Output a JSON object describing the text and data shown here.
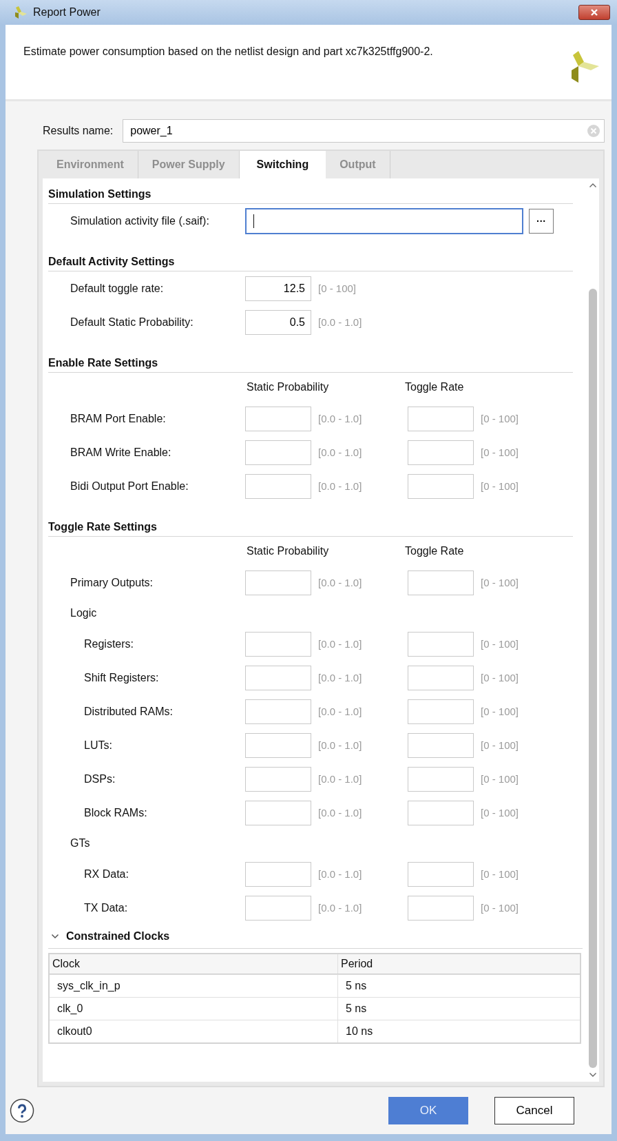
{
  "window": {
    "title": "Report Power"
  },
  "header": {
    "description": "Estimate power consumption based on the netlist design and part xc7k325tffg900-2."
  },
  "results_name": {
    "label": "Results name:",
    "value": "power_1"
  },
  "tabs": [
    {
      "label": "Environment",
      "selected": false
    },
    {
      "label": "Power Supply",
      "selected": false
    },
    {
      "label": "Switching",
      "selected": true
    },
    {
      "label": "Output",
      "selected": false
    }
  ],
  "sections": [
    {
      "title": "Simulation Settings",
      "rows": [
        {
          "kind": "file",
          "label": "Simulation activity file (.saif):",
          "focused": true,
          "button": "···"
        }
      ]
    },
    {
      "title": "Default Activity Settings",
      "rows": [
        {
          "kind": "single",
          "label": "Default toggle rate:",
          "value": "12.5",
          "range": "[0 - 100]"
        },
        {
          "kind": "single",
          "label": "Default Static Probability:",
          "value": "0.5",
          "range": "[0.0 - 1.0]"
        }
      ]
    },
    {
      "title": "Enable Rate Settings",
      "rows": [
        {
          "kind": "columns",
          "columns": [
            "Static Probability",
            "Toggle Rate"
          ]
        },
        {
          "kind": "pair",
          "label": "BRAM Port Enable:",
          "ranges": [
            "[0.0 - 1.0]",
            "[0 - 100]"
          ]
        },
        {
          "kind": "pair",
          "label": "BRAM Write Enable:",
          "ranges": [
            "[0.0 - 1.0]",
            "[0 - 100]"
          ]
        },
        {
          "kind": "pair",
          "label": "Bidi Output Port Enable:",
          "ranges": [
            "[0.0 - 1.0]",
            "[0 - 100]"
          ]
        }
      ]
    },
    {
      "title": "Toggle Rate Settings",
      "rows": [
        {
          "kind": "columns",
          "columns": [
            "Static Probability",
            "Toggle Rate"
          ]
        },
        {
          "kind": "pair",
          "label": "Primary Outputs:",
          "ranges": [
            "[0.0 - 1.0]",
            "[0 - 100]"
          ]
        },
        {
          "kind": "group",
          "label": "Logic",
          "children": [
            {
              "kind": "pair",
              "label": "Registers:",
              "ranges": [
                "[0.0 - 1.0]",
                "[0 - 100]"
              ]
            },
            {
              "kind": "pair",
              "label": "Shift Registers:",
              "ranges": [
                "[0.0 - 1.0]",
                "[0 - 100]"
              ]
            },
            {
              "kind": "pair",
              "label": "Distributed RAMs:",
              "ranges": [
                "[0.0 - 1.0]",
                "[0 - 100]"
              ]
            },
            {
              "kind": "pair",
              "label": "LUTs:",
              "ranges": [
                "[0.0 - 1.0]",
                "[0 - 100]"
              ]
            },
            {
              "kind": "pair",
              "label": "DSPs:",
              "ranges": [
                "[0.0 - 1.0]",
                "[0 - 100]"
              ]
            },
            {
              "kind": "pair",
              "label": "Block RAMs:",
              "ranges": [
                "[0.0 - 1.0]",
                "[0 - 100]"
              ]
            }
          ]
        },
        {
          "kind": "group",
          "label": "GTs",
          "children": [
            {
              "kind": "pair",
              "label": "RX Data:",
              "ranges": [
                "[0.0 - 1.0]",
                "[0 - 100]"
              ]
            },
            {
              "kind": "pair",
              "label": "TX Data:",
              "ranges": [
                "[0.0 - 1.0]",
                "[0 - 100]"
              ]
            }
          ]
        }
      ]
    }
  ],
  "constrained_clocks": {
    "title": "Constrained Clocks",
    "expanded": true,
    "columns": [
      "Clock",
      "Period"
    ],
    "rows": [
      [
        "sys_clk_in_p",
        "5 ns"
      ],
      [
        "clk_0",
        "5 ns"
      ],
      [
        "clkout0",
        "10 ns"
      ]
    ]
  },
  "buttons": {
    "ok": "OK",
    "cancel": "Cancel"
  }
}
